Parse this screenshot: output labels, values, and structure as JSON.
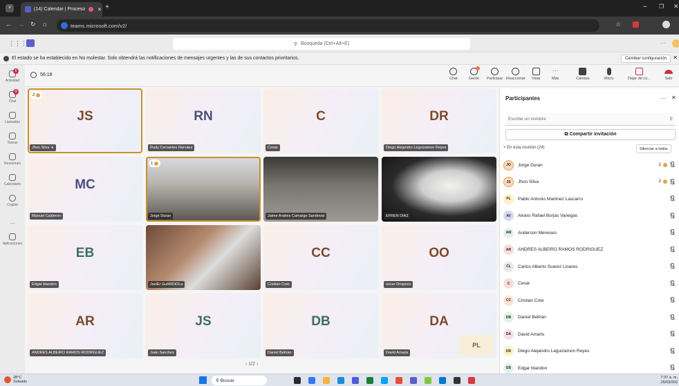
{
  "browser": {
    "tab_title": "(14) Calendar | Proceso con",
    "url": "teams.microsoft.com/v2/"
  },
  "teams": {
    "search_placeholder": "Búsqueda (Ctrl+Alt+E)"
  },
  "notice": {
    "text": "El estado se ha establecido en No molestar. Solo obtendrá las notificaciones de mensajes urgentes y las de sus contactos prioritarios.",
    "button": "Cambiar configuración"
  },
  "rail": [
    {
      "label": "Actividad",
      "badge": "6"
    },
    {
      "label": "Chat",
      "badge": "9"
    },
    {
      "label": "Llamadas"
    },
    {
      "label": "Tareas"
    },
    {
      "label": "Reuniones"
    },
    {
      "label": "Calendario"
    },
    {
      "label": "Copilot"
    },
    {
      "label": "..."
    },
    {
      "label": "Aplicaciones"
    }
  ],
  "meeting": {
    "timer": "56:18",
    "controls": [
      "Chat",
      "Gente",
      "Participar",
      "Reaccionar",
      "Vista",
      "Más",
      "Cámara",
      "Micro",
      "Dejar de co...",
      "Salir"
    ]
  },
  "tiles": [
    {
      "initials": "JS",
      "name": "Jhon Silva",
      "hand": "2",
      "active": true
    },
    {
      "initials": "RN",
      "name": "Rudy Cervantes Narváez"
    },
    {
      "initials": "C",
      "name": "Cesar"
    },
    {
      "initials": "DR",
      "name": "Diego Alejandro Leguizamon Reyes"
    },
    {
      "initials": "MC",
      "name": "Manuel Calderon"
    },
    {
      "name": "Jorge Duran",
      "hand": "1",
      "active": true
    },
    {
      "name": "Jaime Andres Camargo Sandoval"
    },
    {
      "name": "EFREN DIAZ"
    },
    {
      "initials": "EB",
      "name": "Edgar blandon"
    },
    {
      "name": "JaviEr GuARDiOLa"
    },
    {
      "initials": "CC",
      "name": "Cristian Cote"
    },
    {
      "initials": "OO",
      "name": "oscar Oropeza"
    },
    {
      "initials": "AR",
      "name": "ANDRES ALBEIRO RAMOS RODRIGUEZ"
    },
    {
      "initials": "JS",
      "name": "Juan Sanchez"
    },
    {
      "initials": "DB",
      "name": "Daniel Beltrán"
    },
    {
      "initials": "DA",
      "name": "David Amaris",
      "overlay": "PL"
    }
  ],
  "pager": "1/2",
  "panel": {
    "title": "Participantes",
    "search_placeholder": "Escribe un nombre",
    "share_label": "Compartir invitación",
    "in_meeting": "En esta reunión (24)",
    "mute_all": "Silenciar a todos",
    "people": [
      {
        "initials": "JO",
        "name": "Jorge Duran",
        "hand": "1",
        "color": "#f6d8c4"
      },
      {
        "initials": "JS",
        "name": "Jhon Silva",
        "hand": "2",
        "color": "#f6d8c4"
      },
      {
        "initials": "PL",
        "name": "Pablo Antonio Martinez Lascarro",
        "color": "#fff1c4"
      },
      {
        "initials": "AV",
        "name": "Alvaro Rafael Borjas Vanegas",
        "color": "#d5d8f5"
      },
      {
        "initials": "AM",
        "name": "Anderson Meneses",
        "color": "#dff3e6"
      },
      {
        "initials": "AR",
        "name": "ANDRES ALBEIRO RAMOS RODRIGUEZ",
        "color": "#f8dcdc"
      },
      {
        "initials": "CL",
        "name": "Carlos Alberto Suarez Linares",
        "color": "#e7e7e7"
      },
      {
        "initials": "C",
        "name": "Cesar",
        "color": "#f8dcdc"
      },
      {
        "initials": "CC",
        "name": "Cristian Cote",
        "color": "#fbe3d0"
      },
      {
        "initials": "DB",
        "name": "Daniel Beltrán",
        "color": "#dff3e6"
      },
      {
        "initials": "DA",
        "name": "David Amaris",
        "color": "#f6dde6"
      },
      {
        "initials": "DR",
        "name": "Diego Alejandro Leguizamon Reyes",
        "color": "#fff1c4"
      },
      {
        "initials": "EB",
        "name": "Edgar blandon",
        "color": "#dff3e6"
      }
    ]
  },
  "taskbar": {
    "weather_temp": "28°C",
    "weather_desc": "Soleado",
    "search": "Buscar",
    "time": "7:37 a. m.",
    "date": "25/03/202"
  }
}
